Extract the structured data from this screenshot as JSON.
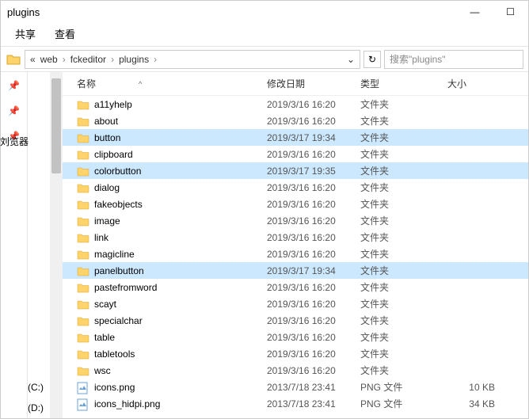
{
  "window": {
    "title": "plugins",
    "minimize": "—",
    "maximize": "☐"
  },
  "menu": {
    "share": "共享",
    "view": "查看"
  },
  "breadcrumb": {
    "lead": "«",
    "p1": "web",
    "p2": "fckeditor",
    "p3": "plugins",
    "sep": "›"
  },
  "refresh": "↻",
  "dropdown": "⌄",
  "search": {
    "placeholder": "搜索\"plugins\""
  },
  "left": {
    "pin": "📌",
    "labels": {
      "browser": "刘览器",
      "c": "(C:)",
      "d": "(D:)"
    }
  },
  "columns": {
    "name": "名称",
    "date": "修改日期",
    "type": "类型",
    "size": "大小",
    "sort": "^"
  },
  "rows": [
    {
      "icon": "folder",
      "name": "a11yhelp",
      "date": "2019/3/16 16:20",
      "type": "文件夹",
      "size": ""
    },
    {
      "icon": "folder",
      "name": "about",
      "date": "2019/3/16 16:20",
      "type": "文件夹",
      "size": ""
    },
    {
      "icon": "folder",
      "name": "button",
      "date": "2019/3/17 19:34",
      "type": "文件夹",
      "size": "",
      "selected": true
    },
    {
      "icon": "folder",
      "name": "clipboard",
      "date": "2019/3/16 16:20",
      "type": "文件夹",
      "size": ""
    },
    {
      "icon": "folder",
      "name": "colorbutton",
      "date": "2019/3/17 19:35",
      "type": "文件夹",
      "size": "",
      "selected": true
    },
    {
      "icon": "folder",
      "name": "dialog",
      "date": "2019/3/16 16:20",
      "type": "文件夹",
      "size": ""
    },
    {
      "icon": "folder",
      "name": "fakeobjects",
      "date": "2019/3/16 16:20",
      "type": "文件夹",
      "size": ""
    },
    {
      "icon": "folder",
      "name": "image",
      "date": "2019/3/16 16:20",
      "type": "文件夹",
      "size": ""
    },
    {
      "icon": "folder",
      "name": "link",
      "date": "2019/3/16 16:20",
      "type": "文件夹",
      "size": ""
    },
    {
      "icon": "folder",
      "name": "magicline",
      "date": "2019/3/16 16:20",
      "type": "文件夹",
      "size": ""
    },
    {
      "icon": "folder",
      "name": "panelbutton",
      "date": "2019/3/17 19:34",
      "type": "文件夹",
      "size": "",
      "selected": true
    },
    {
      "icon": "folder",
      "name": "pastefromword",
      "date": "2019/3/16 16:20",
      "type": "文件夹",
      "size": ""
    },
    {
      "icon": "folder",
      "name": "scayt",
      "date": "2019/3/16 16:20",
      "type": "文件夹",
      "size": ""
    },
    {
      "icon": "folder",
      "name": "specialchar",
      "date": "2019/3/16 16:20",
      "type": "文件夹",
      "size": ""
    },
    {
      "icon": "folder",
      "name": "table",
      "date": "2019/3/16 16:20",
      "type": "文件夹",
      "size": ""
    },
    {
      "icon": "folder",
      "name": "tabletools",
      "date": "2019/3/16 16:20",
      "type": "文件夹",
      "size": ""
    },
    {
      "icon": "folder",
      "name": "wsc",
      "date": "2019/3/16 16:20",
      "type": "文件夹",
      "size": ""
    },
    {
      "icon": "png",
      "name": "icons.png",
      "date": "2013/7/18 23:41",
      "type": "PNG 文件",
      "size": "10 KB"
    },
    {
      "icon": "png",
      "name": "icons_hidpi.png",
      "date": "2013/7/18 23:41",
      "type": "PNG 文件",
      "size": "34 KB"
    }
  ]
}
